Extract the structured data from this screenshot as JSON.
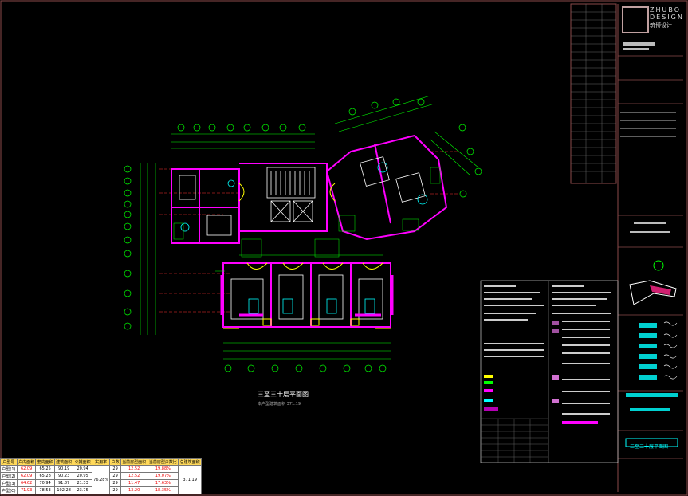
{
  "logo": {
    "line1": "ZHUBO",
    "line2": "DESIGN",
    "cn": "筑博设计"
  },
  "plan": {
    "title": "三至三十层平面图",
    "subtitle": "本户型建筑面积 371.19"
  },
  "drawing_name": "三至三十层平面图",
  "area_table": {
    "headers": [
      "户型号",
      "户内面积",
      "套内面积",
      "建筑面积",
      "公摊面积",
      "实用率",
      "户数",
      "当前房型面积",
      "当前房型户数比",
      "总建筑面积"
    ],
    "rows": [
      {
        "name": "户型(1)",
        "a": "62.09",
        "b": "65.25",
        "c": "90.19",
        "d": "20.94",
        "p": "12.52",
        "q": "19.88%"
      },
      {
        "name": "户型(2)",
        "a": "62.09",
        "b": "65.28",
        "c": "90.23",
        "d": "20.95",
        "p": "12.52",
        "q": "19.07%"
      },
      {
        "name": "户型(3)",
        "a": "64.62",
        "b": "70.94",
        "c": "91.87",
        "d": "21.33",
        "p": "11.47",
        "q": "17.63%"
      },
      {
        "name": "户型(C)",
        "a": "71.93",
        "b": "78.53",
        "c": "102.28",
        "d": "23.75",
        "p": "13.20",
        "q": "18.35%"
      }
    ],
    "ratio": "76.28%",
    "households": "29",
    "total": "371.19"
  },
  "colors": {
    "green": "#00ff00",
    "magenta": "#ff00ff",
    "yellow": "#ffff00",
    "cyan": "#00ffff",
    "white": "#ffffff",
    "red": "#ff3030",
    "frame": "#8b4a4a"
  }
}
